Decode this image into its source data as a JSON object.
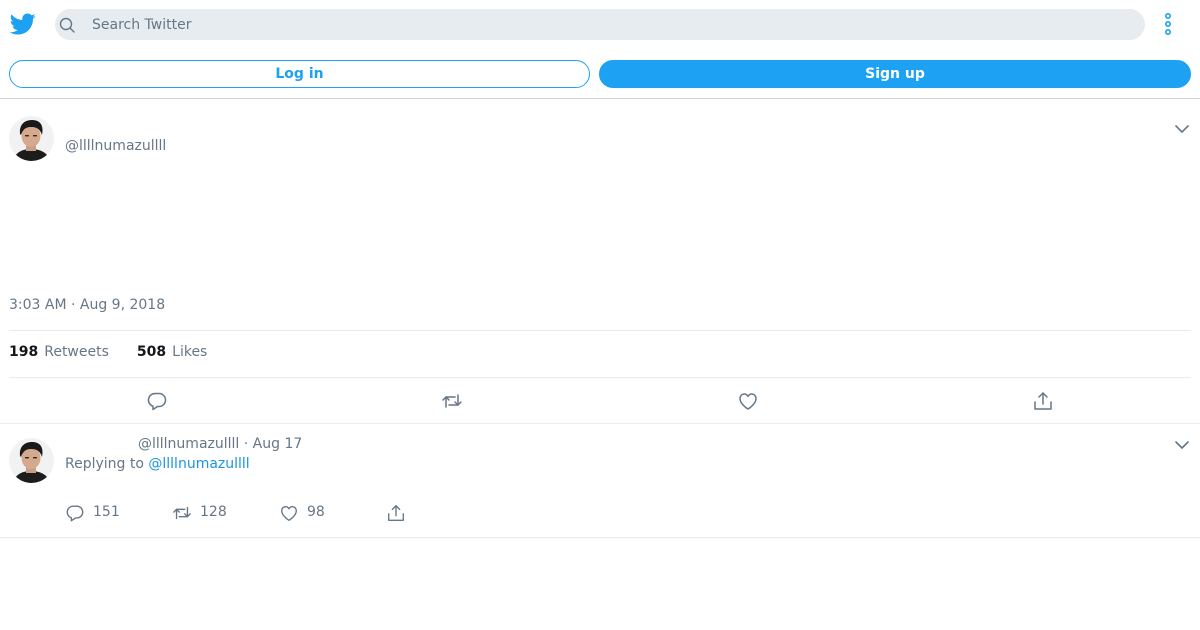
{
  "header": {
    "search_placeholder": "Search Twitter",
    "icons": [
      "twitter-bird-icon",
      "search-icon",
      "more-vertical-icon"
    ]
  },
  "auth": {
    "login_label": "Log in",
    "signup_label": "Sign up"
  },
  "tweet": {
    "handle": "@llllnumazullll",
    "timestamp": "3:03 AM · Aug 9, 2018",
    "retweets_count": "198",
    "retweets_label": "Retweets",
    "likes_count": "508",
    "likes_label": "Likes",
    "actions": [
      "reply-icon",
      "retweet-icon",
      "like-icon",
      "share-icon"
    ]
  },
  "reply": {
    "handle_date": "@llllnumazullll · Aug 17",
    "replying_prefix": "Replying to",
    "replying_handle": "@llllnumazullll",
    "reply_count": "151",
    "retweet_count": "128",
    "like_count": "98"
  },
  "colors": {
    "accent": "#1da1f2",
    "link": "#1b95e0",
    "muted_text": "#657786",
    "search_bg": "#e6ecf0",
    "divider": "#e6ecf0"
  }
}
